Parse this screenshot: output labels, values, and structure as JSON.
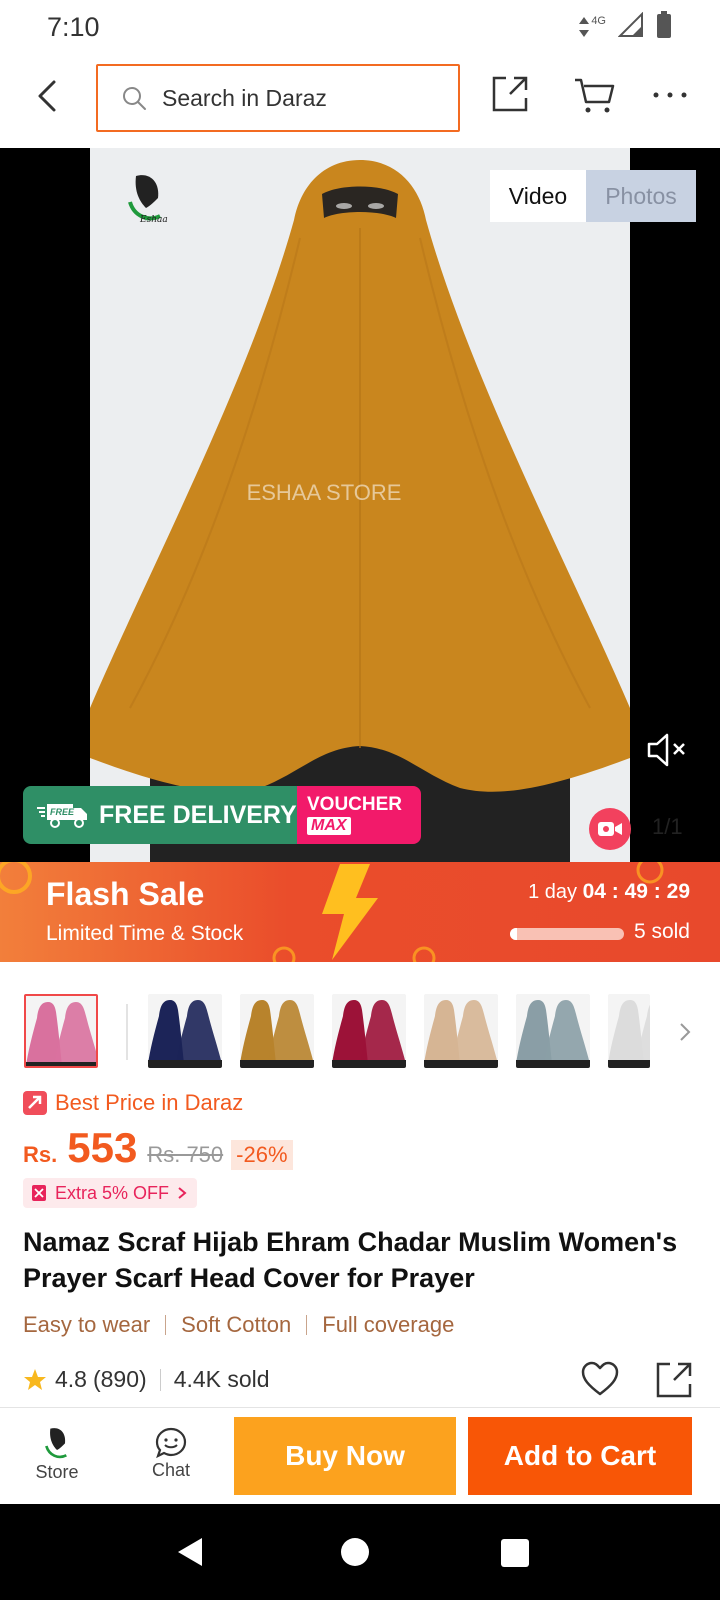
{
  "status_bar": {
    "time": "7:10",
    "network": "4G"
  },
  "top_bar": {
    "search_placeholder": "Search in Daraz"
  },
  "media": {
    "tabs": [
      {
        "label": "Video"
      },
      {
        "label": "Photos"
      }
    ],
    "watermark": "ESHAA STORE",
    "brand_logo": "Eshaa",
    "counter": "1/1",
    "promo": {
      "free_label": "FREE",
      "delivery_label": "FREE DELIVERY",
      "voucher_line1": "VOUCHER",
      "voucher_line2": "MAX"
    }
  },
  "flash_sale": {
    "title": "Flash Sale",
    "subtitle": "Limited Time & Stock",
    "timer_prefix": "1 day",
    "timer": "04 : 49 : 29",
    "sold": "5 sold",
    "sold_progress": 0.06
  },
  "thumbnails": [
    {
      "name": "pink",
      "color": "#d9719e"
    },
    {
      "name": "navy",
      "color": "#1c2458"
    },
    {
      "name": "mustard",
      "color": "#b8832c"
    },
    {
      "name": "maroon",
      "color": "#9c1238"
    },
    {
      "name": "beige",
      "color": "#d6b594"
    },
    {
      "name": "grey-blue",
      "color": "#8a9ea6"
    },
    {
      "name": "white",
      "color": "#dcdcdc"
    }
  ],
  "product": {
    "best_price_label": "Best Price in Daraz",
    "currency": "Rs.",
    "price": "553",
    "old_price": "Rs. 750",
    "discount": "-26%",
    "extra_off": "Extra 5% OFF",
    "title": "Namaz Scraf Hijab Ehram Chadar Muslim Women's Prayer Scarf Head Cover for Prayer",
    "tags": [
      "Easy to wear",
      "Soft Cotton",
      "Full coverage"
    ],
    "rating": "4.8",
    "rating_count": "(890)",
    "sold": "4.4K sold"
  },
  "bottom_bar": {
    "store_label": "Store",
    "chat_label": "Chat",
    "buy_now": "Buy Now",
    "add_to_cart": "Add to Cart"
  },
  "colors": {
    "accent": "#f85606",
    "buy_now": "#fca21e",
    "flash": "#e8492c",
    "price": "#f25a1f"
  }
}
